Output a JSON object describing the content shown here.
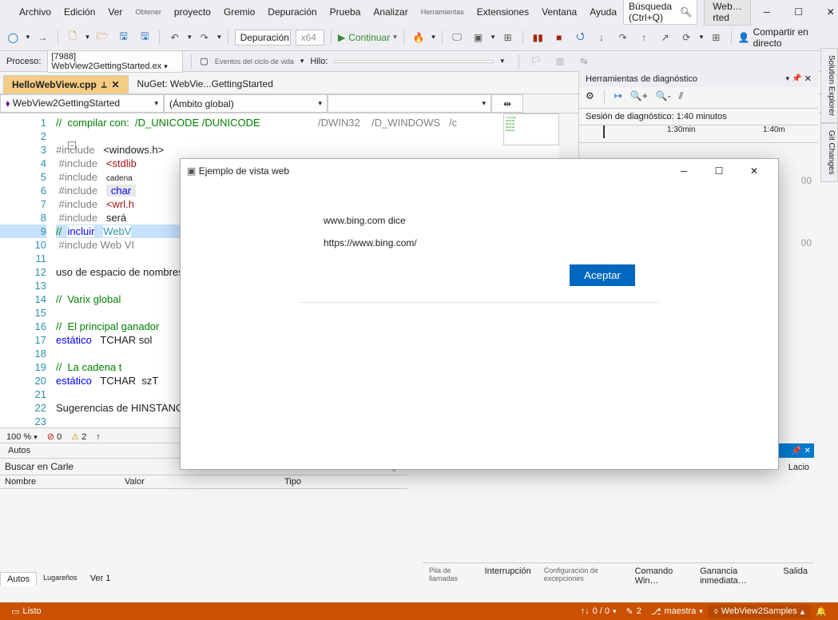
{
  "menu": {
    "archivo": "Archivo",
    "edicion": "Edición",
    "ver": "Ver",
    "obtener": "Obtener",
    "proyecto": "proyecto",
    "gremio": "Gremio",
    "depuracion": "Depuración",
    "prueba": "Prueba",
    "analizar": "Analizar",
    "herramientas": "Herramientas",
    "extensiones": "Extensiones",
    "ventana": "Ventana",
    "ayuda": "Ayuda"
  },
  "search_placeholder": "Búsqueda (Ctrl+Q)",
  "solution_short": "Web…rted",
  "toolbar": {
    "config": "Depuración",
    "platform": "x64",
    "continuar": "Continuar",
    "share": "Compartir en directo"
  },
  "proc": {
    "label": "Proceso:",
    "value": "[7988] WebView2GettingStarted.ex",
    "lifecycle": "Eventos del ciclo de vida",
    "hilo": "Hilo:"
  },
  "tabs": {
    "active": "HelloWebView.cpp",
    "second": "NuGet: WebVie...GettingStarted"
  },
  "nav": {
    "project": "WebView2GettingStarted",
    "scope": "(Ámbito global)"
  },
  "code": {
    "l1": "//  compilar con:  /D_UNICODE /DUNICODE",
    "l1b": "/DWIN32",
    "l1c": "/D_WINDOWS",
    "l1d": "/c",
    "l3a": "#include",
    "l3b": "<windows.h>",
    "l4a": "#include",
    "l4b": "<stdlib",
    "l5a": "#include",
    "l5b": "cadena",
    "l6a": "#include",
    "l6b": "char",
    "l7a": "#include",
    "l7b": "<wrl.h",
    "l8a": "#include",
    "l8b": "será",
    "l9a": "//",
    "l9b": "incluir",
    "l9c": "WebV",
    "l10": "#include Web VI",
    "l12": "uso de espacio de nombres",
    "l14": "//  Varix global",
    "l16": "//  El principal ganador",
    "l17a": "estático",
    "l17b": "TCHAR sol",
    "l19": "//  La cadena t",
    "l20a": "estático",
    "l20b": "TCHAR  szT",
    "l22": "Sugerencias de HINSTANCE"
  },
  "linenums": [
    "1",
    "2",
    "3",
    "4",
    "5",
    "6",
    "7",
    "8",
    "9",
    "10",
    "11",
    "12",
    "13",
    "14",
    "15",
    "16",
    "17",
    "18",
    "19",
    "20",
    "21",
    "22",
    "23"
  ],
  "errbar": {
    "zoom": "100 %",
    "errors": "0",
    "warnings": "2"
  },
  "diag": {
    "title": "Herramientas de diagnóstico",
    "session": "Sesión de diagnóstico: 1:40 minutos",
    "t1": "1:30min",
    "t2": "1:40m",
    "val": "00"
  },
  "autos": {
    "title": "Autos",
    "search": "Buscar en Carle",
    "col1": "Nombre",
    "col2": "Valor",
    "col3": "Tipo",
    "tab1": "Autos",
    "tab2": "Lugareños",
    "tab3": "Ver 1"
  },
  "rightbottom": {
    "t1": "Pila de llamadas",
    "t2": "Interrupción",
    "t3": "Configuración de excepciones",
    "t4": "Comando Win…",
    "t5": "Ganancia inmediata…",
    "t6": "Salida",
    "lacio": "Lacio"
  },
  "status": {
    "ready": "Listo",
    "updown": "0 / 0",
    "pencil": "2",
    "branch": "maestra",
    "repo": "WebView2Samples"
  },
  "sidetabs": {
    "sol": "Solution Explorer",
    "git": "Git Changes"
  },
  "dialog": {
    "title": "Ejemplo de vista web",
    "line1": "www.bing.com dice",
    "line2": "https://www.bing.com/",
    "ok": "Aceptar"
  }
}
